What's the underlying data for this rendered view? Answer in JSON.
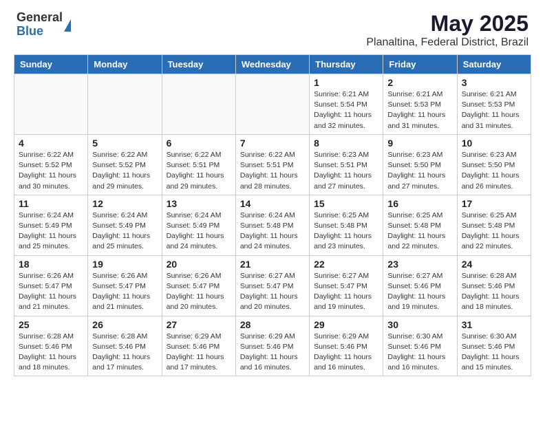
{
  "header": {
    "logo_general": "General",
    "logo_blue": "Blue",
    "title": "May 2025",
    "subtitle": "Planaltina, Federal District, Brazil"
  },
  "days_of_week": [
    "Sunday",
    "Monday",
    "Tuesday",
    "Wednesday",
    "Thursday",
    "Friday",
    "Saturday"
  ],
  "weeks": [
    [
      {
        "day": "",
        "info": ""
      },
      {
        "day": "",
        "info": ""
      },
      {
        "day": "",
        "info": ""
      },
      {
        "day": "",
        "info": ""
      },
      {
        "day": "1",
        "info": "Sunrise: 6:21 AM\nSunset: 5:54 PM\nDaylight: 11 hours\nand 32 minutes."
      },
      {
        "day": "2",
        "info": "Sunrise: 6:21 AM\nSunset: 5:53 PM\nDaylight: 11 hours\nand 31 minutes."
      },
      {
        "day": "3",
        "info": "Sunrise: 6:21 AM\nSunset: 5:53 PM\nDaylight: 11 hours\nand 31 minutes."
      }
    ],
    [
      {
        "day": "4",
        "info": "Sunrise: 6:22 AM\nSunset: 5:52 PM\nDaylight: 11 hours\nand 30 minutes."
      },
      {
        "day": "5",
        "info": "Sunrise: 6:22 AM\nSunset: 5:52 PM\nDaylight: 11 hours\nand 29 minutes."
      },
      {
        "day": "6",
        "info": "Sunrise: 6:22 AM\nSunset: 5:51 PM\nDaylight: 11 hours\nand 29 minutes."
      },
      {
        "day": "7",
        "info": "Sunrise: 6:22 AM\nSunset: 5:51 PM\nDaylight: 11 hours\nand 28 minutes."
      },
      {
        "day": "8",
        "info": "Sunrise: 6:23 AM\nSunset: 5:51 PM\nDaylight: 11 hours\nand 27 minutes."
      },
      {
        "day": "9",
        "info": "Sunrise: 6:23 AM\nSunset: 5:50 PM\nDaylight: 11 hours\nand 27 minutes."
      },
      {
        "day": "10",
        "info": "Sunrise: 6:23 AM\nSunset: 5:50 PM\nDaylight: 11 hours\nand 26 minutes."
      }
    ],
    [
      {
        "day": "11",
        "info": "Sunrise: 6:24 AM\nSunset: 5:49 PM\nDaylight: 11 hours\nand 25 minutes."
      },
      {
        "day": "12",
        "info": "Sunrise: 6:24 AM\nSunset: 5:49 PM\nDaylight: 11 hours\nand 25 minutes."
      },
      {
        "day": "13",
        "info": "Sunrise: 6:24 AM\nSunset: 5:49 PM\nDaylight: 11 hours\nand 24 minutes."
      },
      {
        "day": "14",
        "info": "Sunrise: 6:24 AM\nSunset: 5:48 PM\nDaylight: 11 hours\nand 24 minutes."
      },
      {
        "day": "15",
        "info": "Sunrise: 6:25 AM\nSunset: 5:48 PM\nDaylight: 11 hours\nand 23 minutes."
      },
      {
        "day": "16",
        "info": "Sunrise: 6:25 AM\nSunset: 5:48 PM\nDaylight: 11 hours\nand 22 minutes."
      },
      {
        "day": "17",
        "info": "Sunrise: 6:25 AM\nSunset: 5:48 PM\nDaylight: 11 hours\nand 22 minutes."
      }
    ],
    [
      {
        "day": "18",
        "info": "Sunrise: 6:26 AM\nSunset: 5:47 PM\nDaylight: 11 hours\nand 21 minutes."
      },
      {
        "day": "19",
        "info": "Sunrise: 6:26 AM\nSunset: 5:47 PM\nDaylight: 11 hours\nand 21 minutes."
      },
      {
        "day": "20",
        "info": "Sunrise: 6:26 AM\nSunset: 5:47 PM\nDaylight: 11 hours\nand 20 minutes."
      },
      {
        "day": "21",
        "info": "Sunrise: 6:27 AM\nSunset: 5:47 PM\nDaylight: 11 hours\nand 20 minutes."
      },
      {
        "day": "22",
        "info": "Sunrise: 6:27 AM\nSunset: 5:47 PM\nDaylight: 11 hours\nand 19 minutes."
      },
      {
        "day": "23",
        "info": "Sunrise: 6:27 AM\nSunset: 5:46 PM\nDaylight: 11 hours\nand 19 minutes."
      },
      {
        "day": "24",
        "info": "Sunrise: 6:28 AM\nSunset: 5:46 PM\nDaylight: 11 hours\nand 18 minutes."
      }
    ],
    [
      {
        "day": "25",
        "info": "Sunrise: 6:28 AM\nSunset: 5:46 PM\nDaylight: 11 hours\nand 18 minutes."
      },
      {
        "day": "26",
        "info": "Sunrise: 6:28 AM\nSunset: 5:46 PM\nDaylight: 11 hours\nand 17 minutes."
      },
      {
        "day": "27",
        "info": "Sunrise: 6:29 AM\nSunset: 5:46 PM\nDaylight: 11 hours\nand 17 minutes."
      },
      {
        "day": "28",
        "info": "Sunrise: 6:29 AM\nSunset: 5:46 PM\nDaylight: 11 hours\nand 16 minutes."
      },
      {
        "day": "29",
        "info": "Sunrise: 6:29 AM\nSunset: 5:46 PM\nDaylight: 11 hours\nand 16 minutes."
      },
      {
        "day": "30",
        "info": "Sunrise: 6:30 AM\nSunset: 5:46 PM\nDaylight: 11 hours\nand 16 minutes."
      },
      {
        "day": "31",
        "info": "Sunrise: 6:30 AM\nSunset: 5:46 PM\nDaylight: 11 hours\nand 15 minutes."
      }
    ]
  ]
}
